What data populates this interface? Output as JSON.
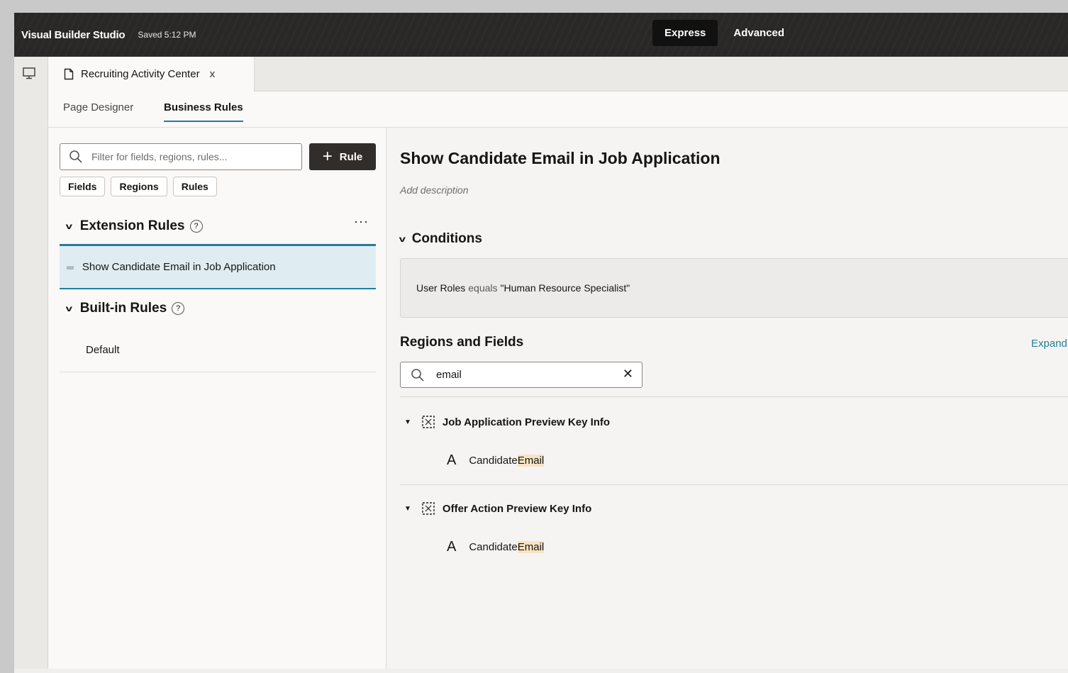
{
  "header": {
    "brand": "Visual Builder Studio",
    "saved": "Saved 5:12 PM",
    "modes": [
      "Express",
      "Advanced"
    ]
  },
  "rail": {
    "icon": "monitor-icon"
  },
  "doc_tab": {
    "label": "Recruiting Activity Center",
    "close": "x"
  },
  "subtabs": [
    "Page Designer",
    "Business Rules"
  ],
  "left": {
    "search_placeholder": "Filter for fields, regions, rules...",
    "add_rule": "Rule",
    "chips": [
      "Fields",
      "Regions",
      "Rules"
    ],
    "extension_heading": "Extension Rules",
    "extension_rules": [
      "Show Candidate Email in Job Application"
    ],
    "builtin_heading": "Built-in Rules",
    "builtin_rules": [
      "Default"
    ]
  },
  "main": {
    "title": "Show Candidate Email in Job Application",
    "description_placeholder": "Add description",
    "conditions_heading": "Conditions",
    "condition": {
      "field": "User Roles",
      "operator": "equals",
      "value": "\"Human Resource Specialist\""
    },
    "regions_heading": "Regions and Fields",
    "expand_link": "Expand",
    "field_search_value": "email",
    "regions": [
      {
        "name": "Job Application Preview Key Info",
        "field_prefix": "Candidate ",
        "field_match": "Email"
      },
      {
        "name": "Offer Action Preview Key Info",
        "field_prefix": "Candidate ",
        "field_match": "Email"
      }
    ]
  }
}
